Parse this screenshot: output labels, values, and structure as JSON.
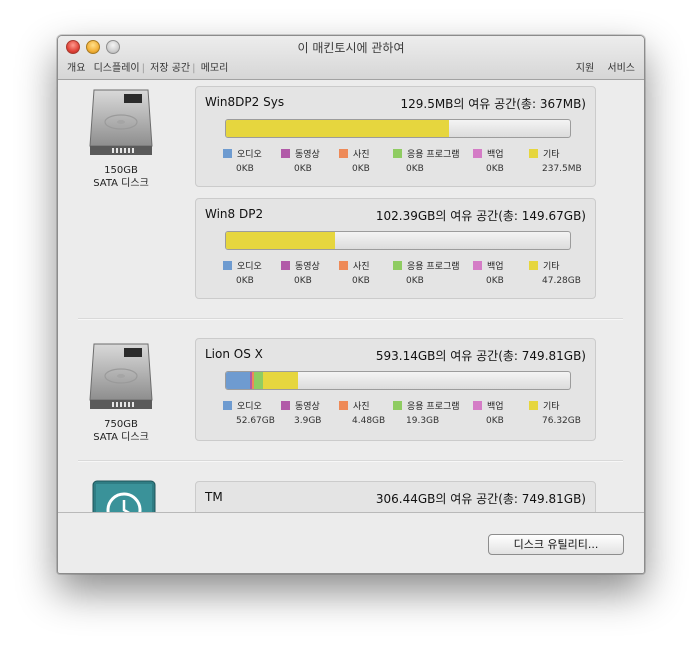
{
  "window": {
    "title": "이 매킨토시에 관하여"
  },
  "tabs": [
    "개요",
    "디스플레이",
    "저장 공간",
    "메모리"
  ],
  "tabs_right": [
    "지원",
    "서비스"
  ],
  "categories": [
    {
      "label": "오디오",
      "color": "#6e9bd0"
    },
    {
      "label": "동영상",
      "color": "#b15aa8"
    },
    {
      "label": "사진",
      "color": "#ee8a58"
    },
    {
      "label": "응용 프로그램",
      "color": "#8fcc62"
    },
    {
      "label": "백업",
      "color": "#d47cc6"
    },
    {
      "label": "기타",
      "color": "#e6d63e"
    }
  ],
  "disks": [
    {
      "size": "150GB",
      "type": "SATA 디스크",
      "icon": "hard-drive-icon"
    },
    {
      "size": "750GB",
      "type": "SATA 디스크",
      "icon": "hard-drive-icon"
    },
    {
      "size": "",
      "type": "",
      "icon": "time-machine-icon"
    }
  ],
  "volumes": [
    {
      "name": "Win8DP2 Sys",
      "free": "129.5MB의 여유 공간(총: 367MB)",
      "fill_fractions": [
        0,
        0,
        0,
        0,
        0,
        0.647
      ],
      "values": [
        "0KB",
        "0KB",
        "0KB",
        "0KB",
        "0KB",
        "237.5MB"
      ]
    },
    {
      "name": "Win8 DP2",
      "free": "102.39GB의 여유 공간(총: 149.67GB)",
      "fill_fractions": [
        0,
        0,
        0,
        0,
        0,
        0.316
      ],
      "values": [
        "0KB",
        "0KB",
        "0KB",
        "0KB",
        "0KB",
        "47.28GB"
      ]
    },
    {
      "name": "Lion OS X",
      "free": "593.14GB의 여유 공간(총: 749.81GB)",
      "fill_fractions": [
        0.07,
        0.005,
        0.006,
        0.026,
        0,
        0.102
      ],
      "values": [
        "52.67GB",
        "3.9GB",
        "4.48GB",
        "19.3GB",
        "0KB",
        "76.32GB"
      ]
    },
    {
      "name": "TM",
      "free": "306.44GB의 여유 공간(총: 749.81GB)",
      "fill_fractions": [],
      "values": []
    }
  ],
  "footer": {
    "disk_utility_label": "디스크 유틸리티..."
  }
}
